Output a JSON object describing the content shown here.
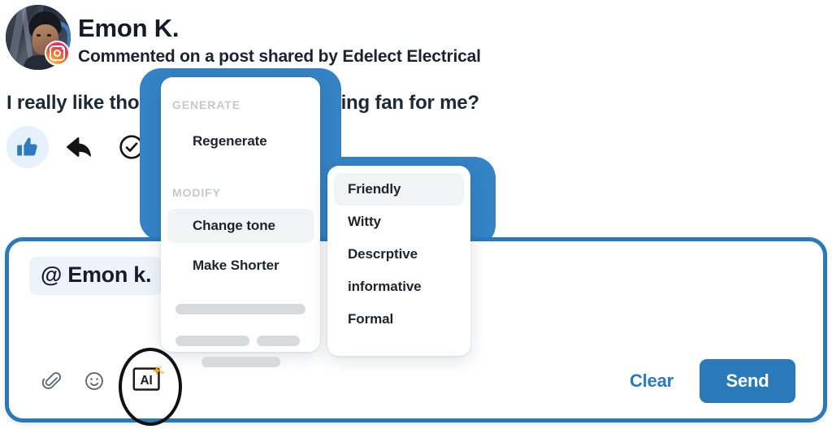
{
  "header": {
    "user_name": "Emon K.",
    "subtitle": "Commented on a post shared by Edelect Electrical",
    "avatar_icon": "user-photo-avatar",
    "platform_badge_icon": "instagram-icon"
  },
  "comment": {
    "text": "I really like those lig                 e to install  a ceiling fan for me?",
    "reactions": [
      {
        "icon": "thumbs-up-icon",
        "name": "like-reaction"
      },
      {
        "icon": "reply-arrow-icon",
        "name": "reply-action"
      },
      {
        "icon": "check-circle-icon",
        "name": "mark-done-action"
      }
    ]
  },
  "ai_menu": {
    "generate_label": "GENERATE",
    "modify_label": "MODIFY",
    "items": [
      {
        "label": "Regenerate",
        "active": false
      },
      {
        "label": "Change tone",
        "active": true
      },
      {
        "label": "Make Shorter",
        "active": false
      }
    ]
  },
  "tone_menu": {
    "options": [
      {
        "label": "Friendly",
        "active": true
      },
      {
        "label": "Witty",
        "active": false
      },
      {
        "label": "Descrptive",
        "active": false
      },
      {
        "label": "informative",
        "active": false
      },
      {
        "label": "Formal",
        "active": false
      }
    ]
  },
  "composer": {
    "mention_chip": "@ Emon k.",
    "attachment_icon": "paperclip-icon",
    "emoji_icon": "smiley-face-icon",
    "ai_icon": "ai-sparkle-icon",
    "ai_icon_label": "AI",
    "clear_label": "Clear",
    "send_label": "Send"
  },
  "colors": {
    "brand_blue": "#2a79b8",
    "highlight_blue": "#3483c4",
    "accent_orange": "#f5a623",
    "text_dark": "#1e2936",
    "muted_gray": "#c4c9cf"
  }
}
